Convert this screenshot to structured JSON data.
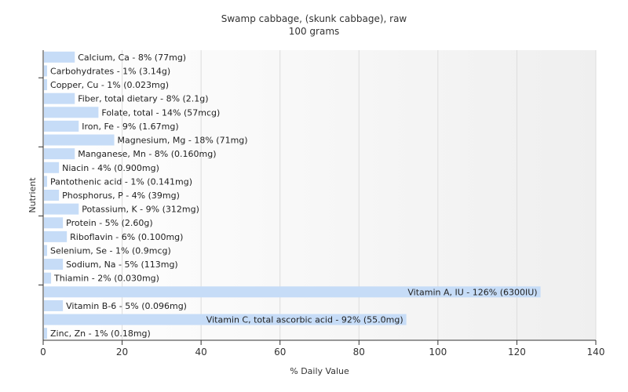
{
  "chart_data": {
    "type": "bar",
    "orientation": "horizontal",
    "title": "Swamp cabbage, (skunk cabbage), raw",
    "subtitle": "100 grams",
    "xlabel": "% Daily Value",
    "ylabel": "Nutrient",
    "xlim": [
      0,
      140
    ],
    "xticks": [
      0,
      20,
      40,
      60,
      80,
      100,
      120,
      140
    ],
    "grid": true,
    "bar_color": "#c6dcf7",
    "categories": [
      "Calcium, Ca",
      "Carbohydrates",
      "Copper, Cu",
      "Fiber, total dietary",
      "Folate, total",
      "Iron, Fe",
      "Magnesium, Mg",
      "Manganese, Mn",
      "Niacin",
      "Pantothenic acid",
      "Phosphorus, P",
      "Potassium, K",
      "Protein",
      "Riboflavin",
      "Selenium, Se",
      "Sodium, Na",
      "Thiamin",
      "Vitamin A, IU",
      "Vitamin B-6",
      "Vitamin C, total ascorbic acid",
      "Zinc, Zn"
    ],
    "values": [
      8,
      1,
      1,
      8,
      14,
      9,
      18,
      8,
      4,
      1,
      4,
      9,
      5,
      6,
      1,
      5,
      2,
      126,
      5,
      92,
      1
    ],
    "labels": [
      "Calcium, Ca - 8% (77mg)",
      "Carbohydrates - 1% (3.14g)",
      "Copper, Cu - 1% (0.023mg)",
      "Fiber, total dietary - 8% (2.1g)",
      "Folate, total - 14% (57mcg)",
      "Iron, Fe - 9% (1.67mg)",
      "Magnesium, Mg - 18% (71mg)",
      "Manganese, Mn - 8% (0.160mg)",
      "Niacin - 4% (0.900mg)",
      "Pantothenic acid - 1% (0.141mg)",
      "Phosphorus, P - 4% (39mg)",
      "Potassium, K - 9% (312mg)",
      "Protein - 5% (2.60g)",
      "Riboflavin - 6% (0.100mg)",
      "Selenium, Se - 1% (0.9mcg)",
      "Sodium, Na - 5% (113mg)",
      "Thiamin - 2% (0.030mg)",
      "Vitamin A, IU - 126% (6300IU)",
      "Vitamin B-6 - 5% (0.096mg)",
      "Vitamin C, total ascorbic acid - 92% (55.0mg)",
      "Zinc, Zn - 1% (0.18mg)"
    ]
  }
}
